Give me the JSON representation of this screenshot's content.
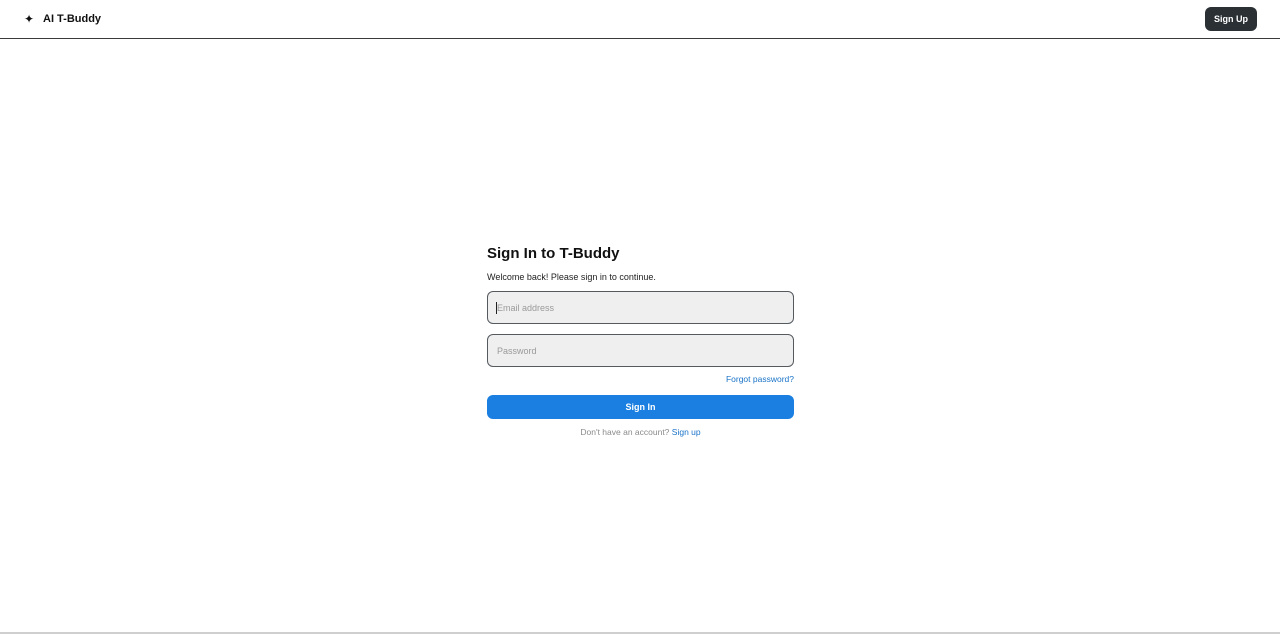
{
  "header": {
    "brand_icon": "✦",
    "brand_name": "AI T-Buddy",
    "signup_label": "Sign Up"
  },
  "signin": {
    "title": "Sign In to T-Buddy",
    "subtitle": "Welcome back! Please sign in to continue.",
    "email_placeholder": "Email address",
    "password_placeholder": "Password",
    "forgot_label": "Forgot password?",
    "submit_label": "Sign In",
    "no_account_text": "Don't have an account?",
    "signup_link_label": "Sign up"
  },
  "colors": {
    "primary": "#1a7fe0",
    "link": "#1a73c8",
    "dark_button": "#2b3035",
    "input_bg": "#efefef"
  },
  "icons": {
    "brand": "sparkle-icon"
  }
}
